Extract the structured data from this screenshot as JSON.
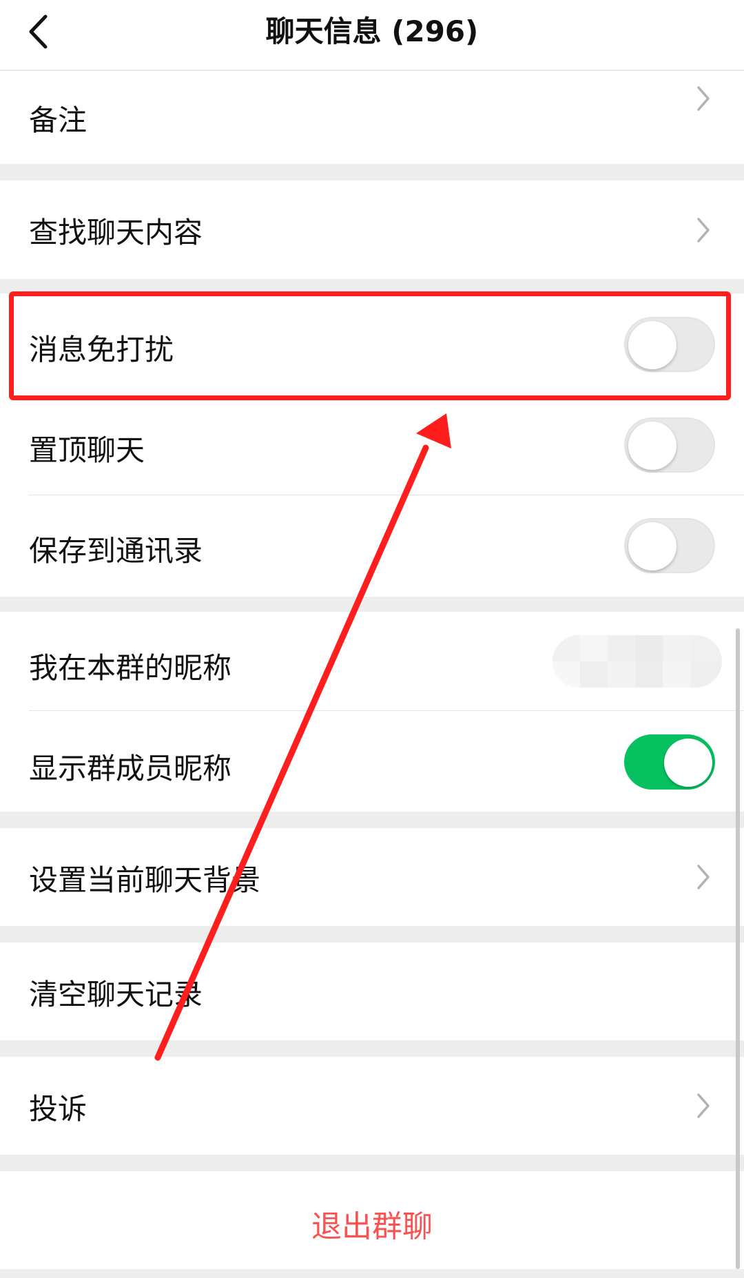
{
  "navbar": {
    "title": "聊天信息 (296)",
    "back_icon": "chevron-left-icon"
  },
  "cells": {
    "remark": "备注",
    "search_chat": "查找聊天内容",
    "mute_notifications": "消息免打扰",
    "sticky_on_top": "置顶聊天",
    "save_to_contacts": "保存到通讯录",
    "my_group_nickname": "我在本群的昵称",
    "show_member_nicknames": "显示群成员昵称",
    "set_chat_background": "设置当前聊天背景",
    "clear_chat_history": "清空聊天记录",
    "report": "投诉"
  },
  "toggles": {
    "mute_notifications": false,
    "sticky_on_top": false,
    "save_to_contacts": false,
    "show_member_nicknames": true
  },
  "exit_group": "退出群聊",
  "colors": {
    "accent_green": "#07c160",
    "danger_red": "#fa5151",
    "annotation_red": "#ff1e1e",
    "background": "#ededed"
  },
  "icons": {
    "chevron": "chevron-right-icon",
    "annotation": "red-arrow-annotation"
  }
}
